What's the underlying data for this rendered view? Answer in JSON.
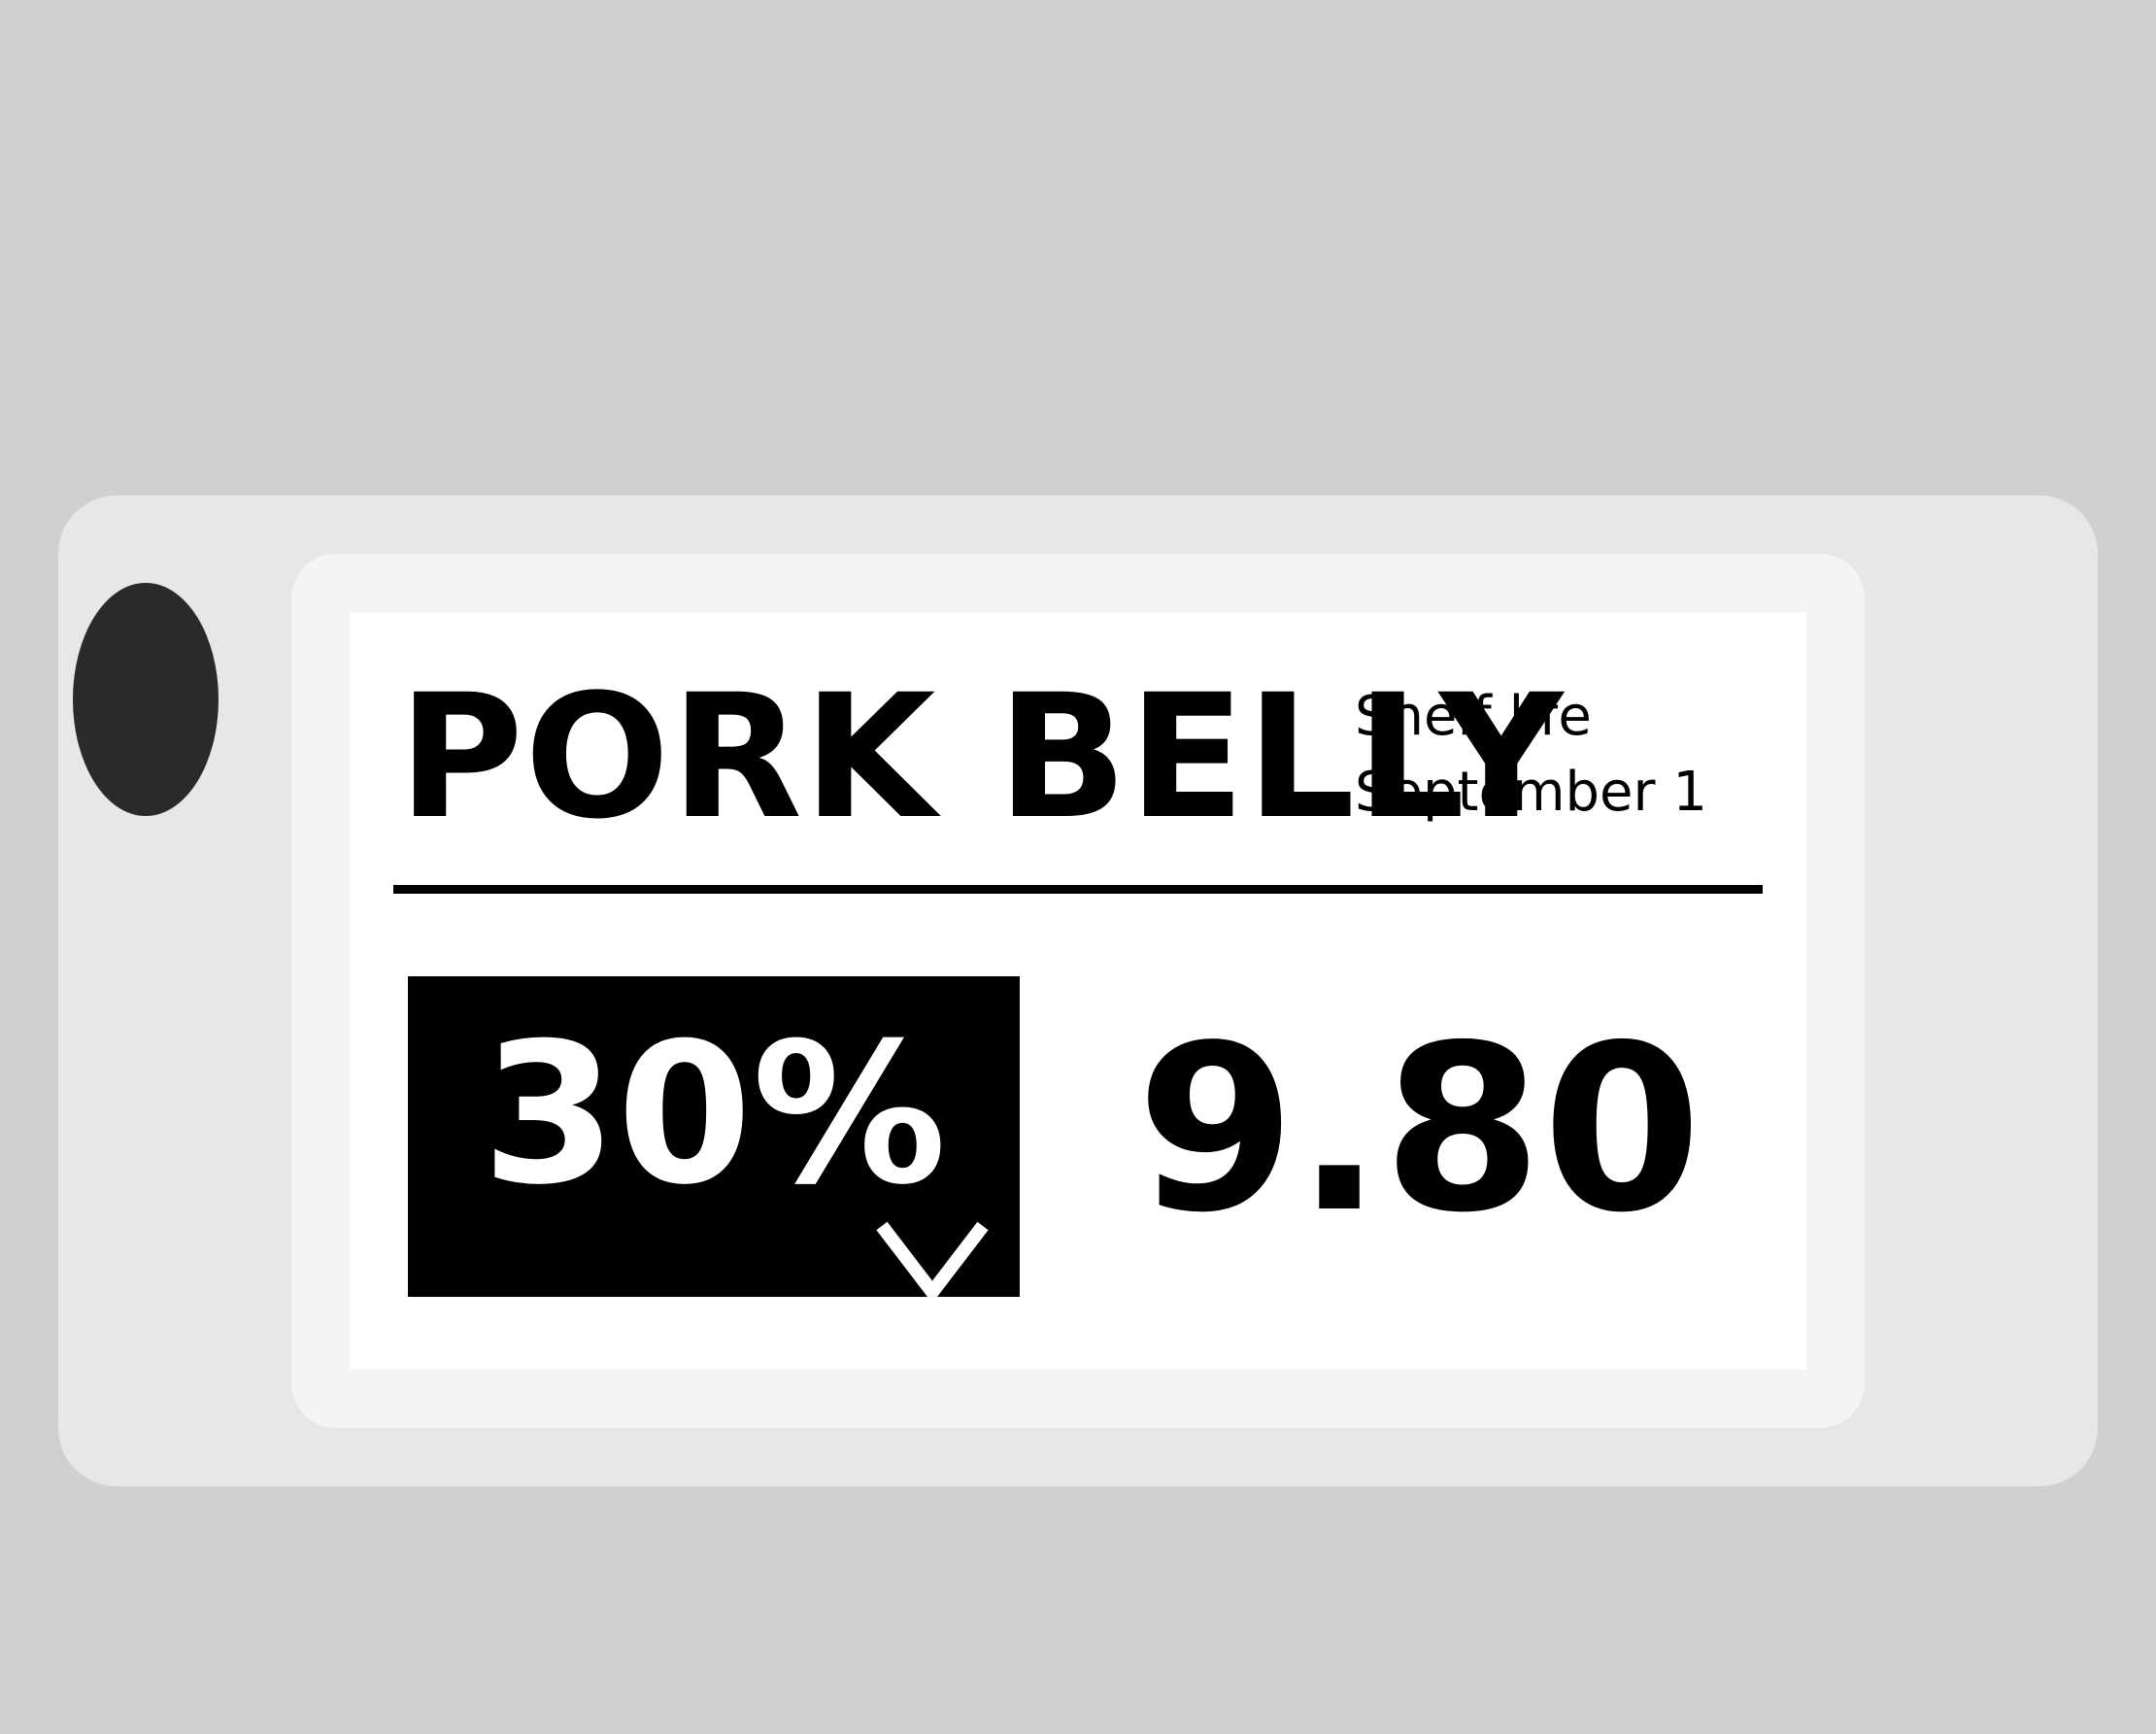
{
  "label": {
    "product_name": "PORK BELLY",
    "shelf_life_label": "Shelf life",
    "shelf_life_date": "September 1",
    "discount": "30%",
    "price": "9.80",
    "discount_icon": "chevron-down-icon"
  },
  "colors": {
    "background": "#d0d0d0",
    "device_body": "#e7e7e7",
    "bezel": "#f4f4f4",
    "screen": "#ffffff",
    "ink": "#000000",
    "mount_hole": "#2a2a2a"
  }
}
